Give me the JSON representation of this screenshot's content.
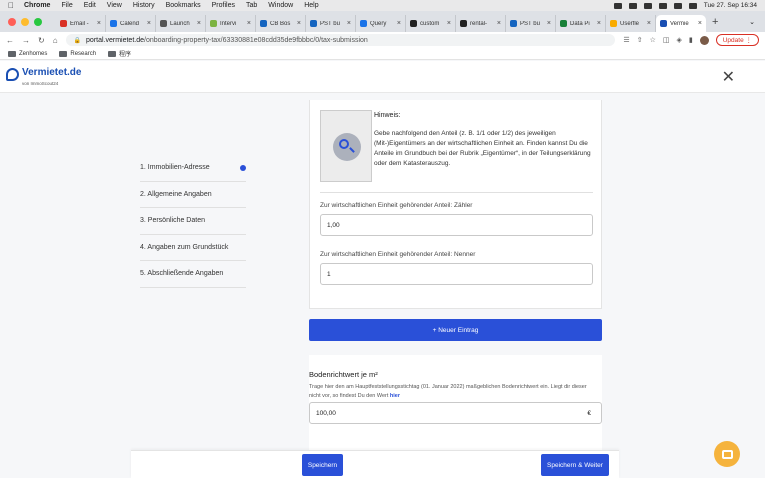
{
  "menubar": {
    "app": "Chrome",
    "items": [
      "File",
      "Edit",
      "View",
      "History",
      "Bookmarks",
      "Profiles",
      "Tab",
      "Window",
      "Help"
    ],
    "clock": "Tue 27. Sep 16:34"
  },
  "tabs": [
    {
      "label": "Email -",
      "color": "#d93025"
    },
    {
      "label": "Calend",
      "color": "#1a73e8"
    },
    {
      "label": "Launch",
      "color": "#555555"
    },
    {
      "label": "Intervi",
      "color": "#7cb342"
    },
    {
      "label": "CB Bos",
      "color": "#1565c0"
    },
    {
      "label": "PST bu",
      "color": "#1565c0"
    },
    {
      "label": "Query",
      "color": "#1a73e8"
    },
    {
      "label": "custom",
      "color": "#222222"
    },
    {
      "label": "rental-",
      "color": "#222222"
    },
    {
      "label": "PST bu",
      "color": "#1565c0"
    },
    {
      "label": "Data Pi",
      "color": "#188038"
    },
    {
      "label": "Userfle",
      "color": "#f9ab00"
    },
    {
      "label": "Vermie",
      "color": "#1a4fb3",
      "active": true
    }
  ],
  "address": {
    "host": "portal.vermietet.de",
    "path": "/onboarding-property-tax/63330881e08cdd35de9fbbbc/0/tax-submission",
    "update_label": "Update"
  },
  "bookmarks": [
    "Zenhomes",
    "Research",
    "程序"
  ],
  "site": {
    "logo": "Vermietet.de",
    "logo_sub": "von ImmoScout24",
    "close": "✕"
  },
  "steps": [
    "1. Immobilien-Adresse",
    "2. Allgemeine Angaben",
    "3. Persönliche Daten",
    "4. Angaben zum Grundstück",
    "5. Abschließende Angaben"
  ],
  "hint": {
    "title": "Hinweis:",
    "text": "Gebe nachfolgend den Anteil (z. B. 1/1 oder 1/2) des jeweiligen (Mit-)Eigentümers an der wirtschaftlichen Einheit an. Finden kannst Du die Anteile im Grundbuch bei der Rubrik „Eigentümer“, in der Teilungserklärung oder dem Katasterauszug."
  },
  "fields": {
    "zaehler_label": "Zur wirtschaftlichen Einheit gehörender Anteil: Zähler",
    "zaehler_value": "1,00",
    "nenner_label": "Zur wirtschaftlichen Einheit gehörender Anteil: Nenner",
    "nenner_value": "1"
  },
  "add_entry": "+ Neuer Eintrag",
  "bodenrichtwert": {
    "title": "Bodenrichtwert je m²",
    "desc_pre": "Trage hier den am Hauptfeststellungsstichtag (01. Januar 2022) maßgeblichen Bodenrichtwert ein. Liegt dir dieser nicht vor, so findest Du den Wert ",
    "desc_link": "hier",
    "value": "100,00",
    "unit": "€"
  },
  "footer": {
    "save": "Speichern",
    "save_next": "Speichern & Weiter"
  }
}
